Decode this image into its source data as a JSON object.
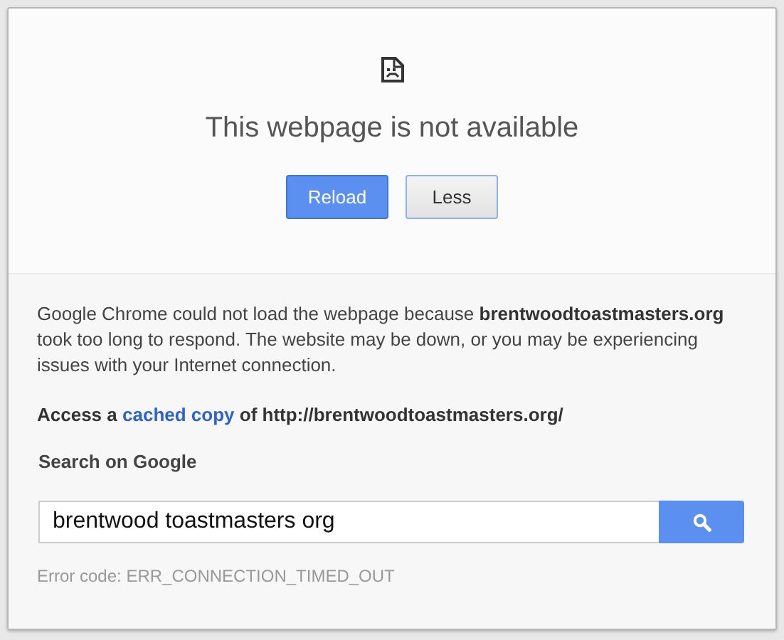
{
  "title": "This webpage is not available",
  "buttons": [
    {
      "label": "Reload",
      "kind": "primary"
    },
    {
      "label": "Less",
      "kind": "secondary"
    }
  ],
  "details": {
    "message": "Google Chrome could not load the webpage because **brentwoodtoastmasters.org** took too long to respond. The website may be down, or you may be experiencing issues with your Internet connection.",
    "access": {
      "prefix": "Access a ",
      "link": "cached copy",
      "suffix": " of http://brentwoodtoastmasters.org/"
    },
    "search_heading": "Search on Google",
    "search": {
      "value": "brentwood toastmasters org"
    },
    "error_code": "Error code: ERR_CONNECTION_TIMED_OUT"
  }
}
